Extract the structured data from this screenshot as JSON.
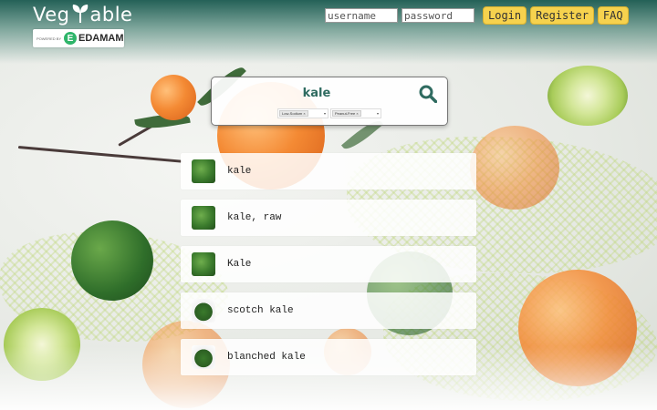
{
  "app": {
    "logo_left": "Veg",
    "logo_right": "able"
  },
  "partner": {
    "powered_by": "POWERED BY",
    "badge_letter": "E",
    "name": "EDAMAM"
  },
  "auth": {
    "username_placeholder": "username",
    "password_placeholder": "password",
    "login_label": "Login",
    "register_label": "Register",
    "faq_label": "FAQ"
  },
  "search": {
    "query": "kale",
    "filters": [
      {
        "tag": "Low-Sodium ×",
        "caret": "▾"
      },
      {
        "tag": "Peanut-Free ×",
        "caret": "▾"
      }
    ]
  },
  "results": [
    {
      "label": "kale"
    },
    {
      "label": "kale, raw"
    },
    {
      "label": "Kale"
    },
    {
      "label": "scotch kale"
    },
    {
      "label": "blanched kale"
    }
  ],
  "colors": {
    "accent": "#f6d24e",
    "brand": "#2f6b60",
    "edamam_green": "#2fb56a"
  },
  "icons": {
    "search": "search-icon",
    "sprout": "sprout-icon"
  }
}
